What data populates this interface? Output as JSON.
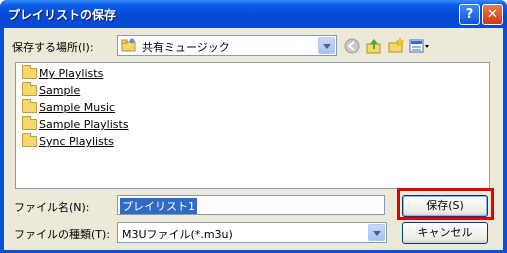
{
  "dialog": {
    "title": "プレイリストの保存",
    "help_label": "?",
    "close_label": "✕"
  },
  "location": {
    "label": "保存する場所(I):",
    "value": "共有ミュージック"
  },
  "toolbar": {
    "icons": [
      "back-icon",
      "up-folder-icon",
      "new-folder-icon",
      "view-menu-icon"
    ]
  },
  "files": [
    {
      "name": "My Playlists"
    },
    {
      "name": "Sample"
    },
    {
      "name": "Sample Music"
    },
    {
      "name": "Sample Playlists"
    },
    {
      "name": "Sync Playlists"
    }
  ],
  "filename": {
    "label": "ファイル名(N):",
    "value": "プレイリスト1"
  },
  "filetype": {
    "label": "ファイルの種類(T):",
    "value": "M3Uファイル(*.m3u)"
  },
  "buttons": {
    "save": "保存(S)",
    "cancel": "キャンセル"
  },
  "colors": {
    "title_bar": "#0548d0",
    "highlight": "#e00000"
  }
}
